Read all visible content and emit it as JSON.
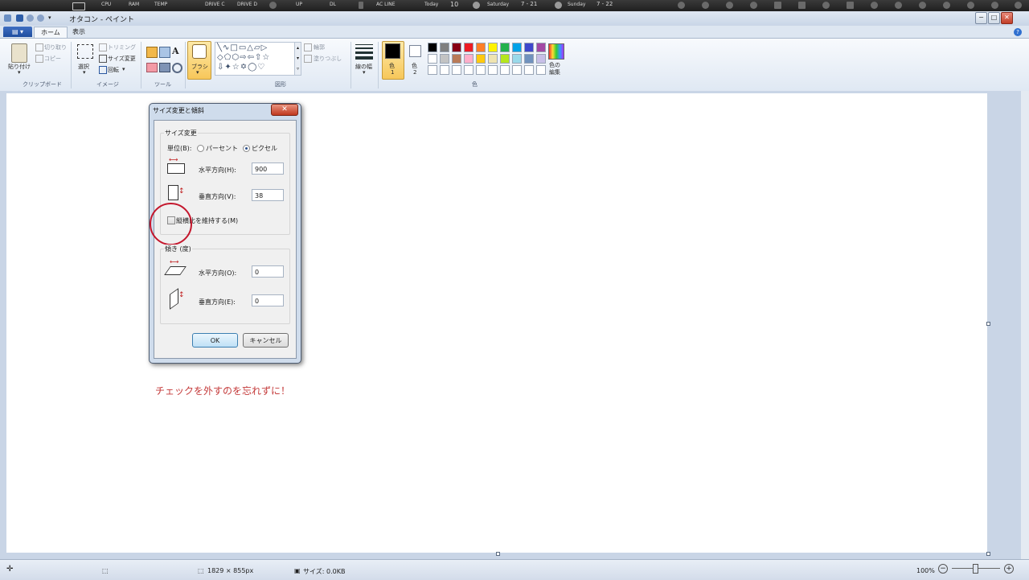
{
  "sysbar": {
    "items": [
      "CPU",
      "RAM",
      "TEMP",
      "DRIVE C",
      "DRIVE D",
      "UP",
      "DL",
      "AC LINE",
      "Today",
      "10",
      "Saturday",
      "7 - 21",
      "Sunday",
      "7 - 22"
    ]
  },
  "window": {
    "title": "オタコン - ペイント",
    "buttons": {
      "minimize": "−",
      "maximize": "□",
      "close": "✕"
    }
  },
  "tabs": [
    {
      "label": "ホーム",
      "active": true
    },
    {
      "label": "表示",
      "active": false
    }
  ],
  "ribbon": {
    "clipboard": {
      "paste": "貼り付け",
      "cut": "切り取り",
      "copy": "コピー",
      "group": "クリップボード"
    },
    "image": {
      "select": "選択",
      "crop": "トリミング",
      "resize": "サイズ変更",
      "rotate": "回転",
      "group": "イメージ"
    },
    "tools": {
      "group": "ツール"
    },
    "brush": {
      "label": "ブラシ"
    },
    "shapes": {
      "outline": "輪郭",
      "fill": "塗りつぶし",
      "group": "図形"
    },
    "line_width": {
      "label": "線の幅"
    },
    "color1": {
      "label": "色",
      "sub": "1"
    },
    "color2": {
      "label": "色",
      "sub": "2"
    },
    "colors_group": "色",
    "edit_colors": {
      "label": "色の編集"
    },
    "palette": [
      "#000000",
      "#7f7f7f",
      "#880015",
      "#ed1c24",
      "#ff7f27",
      "#fff200",
      "#22b14c",
      "#00a2e8",
      "#3f48cc",
      "#a349a4",
      "#ffffff",
      "#c3c3c3",
      "#b97a57",
      "#ffaec9",
      "#ffc90e",
      "#efe4b0",
      "#b5e61d",
      "#99d9ea",
      "#7092be",
      "#c8bfe7"
    ]
  },
  "dialog": {
    "title": "サイズ変更と傾斜",
    "resize_section": "サイズ変更",
    "unit_label": "単位(B):",
    "percent": "パーセント",
    "pixel": "ピクセル",
    "horizontal_label": "水平方向(H):",
    "horizontal_value": "900",
    "vertical_label": "垂直方向(V):",
    "vertical_value": "38",
    "keep_ratio": "縦横比を維持する(M)",
    "skew_section": "傾き (度)",
    "skew_h_label": "水平方向(O):",
    "skew_h_value": "0",
    "skew_v_label": "垂直方向(E):",
    "skew_v_value": "0",
    "ok": "OK",
    "cancel": "キャンセル"
  },
  "annotation": "チェックを外すのを忘れずに！",
  "status": {
    "dimensions": "1829 × 855px",
    "size": "サイズ: 0.0KB",
    "zoom": "100%"
  }
}
